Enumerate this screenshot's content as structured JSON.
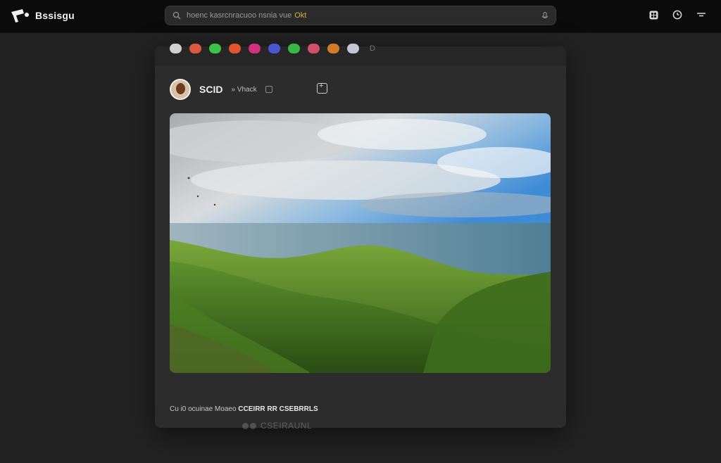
{
  "brand": {
    "name": "Bssisgu",
    "logo_icon": "camera-logo-icon"
  },
  "search": {
    "text": "hoenc kasrcnracuoo nsnia vue",
    "highlight": "Okt",
    "icon": "search-icon",
    "mic_icon": "mic-icon"
  },
  "top_actions": [
    {
      "name": "grid-icon"
    },
    {
      "name": "clock-icon"
    },
    {
      "name": "menu-icon"
    }
  ],
  "reactions": {
    "items": [
      {
        "name": "reaction-gray",
        "color": "#d0d0d0"
      },
      {
        "name": "reaction-red",
        "color": "#d9583e"
      },
      {
        "name": "reaction-green",
        "color": "#3cc24a"
      },
      {
        "name": "reaction-orange",
        "color": "#e0552c"
      },
      {
        "name": "reaction-pink",
        "color": "#d2317e"
      },
      {
        "name": "reaction-blue",
        "color": "#4a56d0"
      },
      {
        "name": "reaction-green-2",
        "color": "#37b845"
      },
      {
        "name": "reaction-rose",
        "color": "#d05068"
      },
      {
        "name": "reaction-amber",
        "color": "#d27a28"
      },
      {
        "name": "reaction-silver",
        "color": "#c4c4d4"
      }
    ],
    "more": "D"
  },
  "post": {
    "author_name": "SCID",
    "author_meta": "» Vhack",
    "caption_prefix": "Cu i0 ocuinae Moaeo",
    "caption_bold": "CCEIRR RR CSEBRRLS",
    "footer_text": "CSEIRAUNL"
  },
  "colors": {
    "accent": "#d6b43a",
    "card": "#2c2c2c",
    "page": "#222222",
    "topbar": "#0b0b0b"
  }
}
